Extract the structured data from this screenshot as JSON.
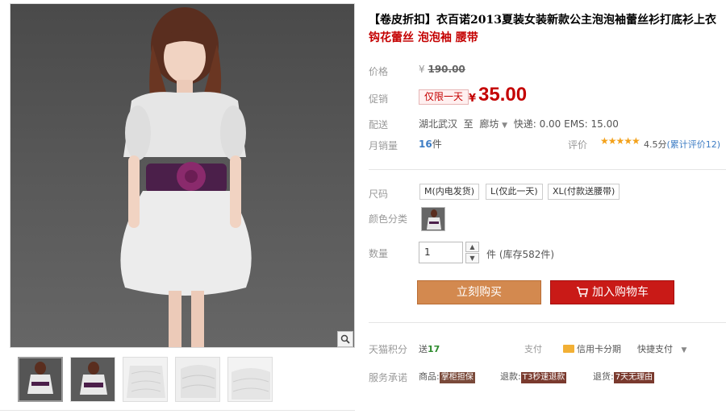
{
  "product": {
    "title_prefix": "【卷皮折扣】",
    "title_main": "衣百诺2013夏装女装新款公主泡泡袖蕾丝衫打底衫上衣",
    "title_highlight": "钩花蕾丝 泡泡袖 腰带"
  },
  "price": {
    "label": "价格",
    "currency": "¥",
    "original": "190.00",
    "promo_label": "促销",
    "promo_tag": "仅限一天",
    "current": "35.00"
  },
  "shipping": {
    "label": "配送",
    "from": "湖北武汉",
    "to_word": "至",
    "destination": "廊坊",
    "fees": "快递: 0.00 EMS: 15.00"
  },
  "sales": {
    "label": "月销量",
    "count": "16",
    "unit": "件",
    "rating_label": "评价",
    "stars": "★★★★★",
    "score": "4.5分",
    "reviews": "(累计评价12)"
  },
  "options": {
    "size_label": "尺码",
    "sizes": [
      "M(内电发货)",
      "L(仅此一天)",
      "XL(付款送腰带)"
    ],
    "color_label": "颜色分类",
    "qty_label": "数量",
    "qty_value": "1",
    "stock_text": "件 (库存582件)"
  },
  "actions": {
    "buy_now": "立刻购买",
    "add_to_cart": "加入购物车"
  },
  "service": {
    "tmall_label": "天猫积分",
    "points_prefix": "送",
    "points": "17",
    "pay_label": "支付",
    "credit_installment": "信用卡分期",
    "quick_pay": "快捷支付",
    "promise_label": "服务承诺",
    "item1_prefix": "商品:",
    "item1_badge": "掌柜担保",
    "item2_prefix": "退款:",
    "item2_badge": "T3秒速退款",
    "item3_prefix": "退货:",
    "item3_badge": "7天无理由"
  },
  "colors": {
    "price_red": "#c40000",
    "buy_button": "#d3894f",
    "cart_button": "#c91a17",
    "link_blue": "#3c7cc4",
    "star": "#f3a21c"
  }
}
